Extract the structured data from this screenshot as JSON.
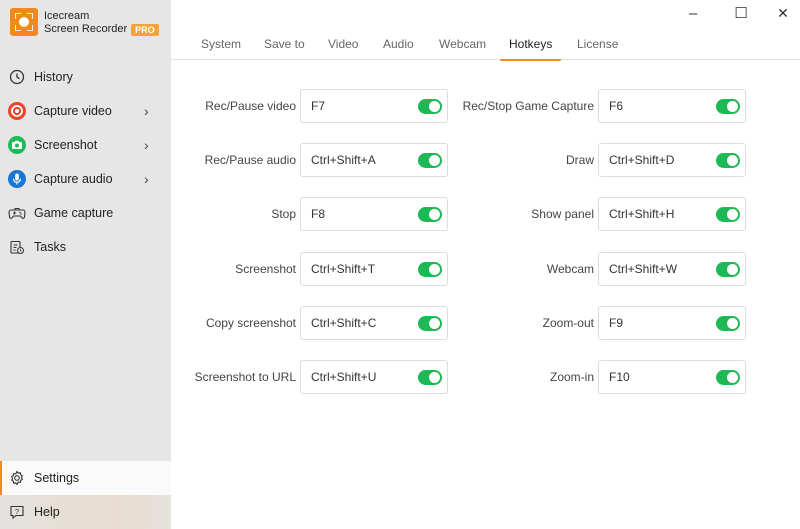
{
  "app": {
    "name_line1": "Icecream",
    "name_line2": "Screen Recorder",
    "badge": "PRO",
    "accent_color": "#f08a1c",
    "toggle_color": "#1db954"
  },
  "sidebar": {
    "items": [
      {
        "label": "History",
        "icon": "clock-icon",
        "has_submenu": false
      },
      {
        "label": "Capture video",
        "icon": "record-icon",
        "has_submenu": true,
        "color": "#e8452c"
      },
      {
        "label": "Screenshot",
        "icon": "camera-icon",
        "has_submenu": true,
        "color": "#1fba5a"
      },
      {
        "label": "Capture audio",
        "icon": "microphone-icon",
        "has_submenu": true,
        "color": "#1976d2"
      },
      {
        "label": "Game capture",
        "icon": "gamepad-icon",
        "has_submenu": false
      },
      {
        "label": "Tasks",
        "icon": "tasks-icon",
        "has_submenu": false
      }
    ],
    "bottom": [
      {
        "label": "Settings",
        "icon": "gear-icon",
        "active": true
      },
      {
        "label": "Help",
        "icon": "help-icon",
        "active": false
      }
    ],
    "chevron": "›"
  },
  "window": {
    "minimize": "–",
    "maximize": "☐",
    "close": "✕"
  },
  "tabs": [
    {
      "label": "System",
      "active": false
    },
    {
      "label": "Save to",
      "active": false
    },
    {
      "label": "Video",
      "active": false
    },
    {
      "label": "Audio",
      "active": false
    },
    {
      "label": "Webcam",
      "active": false
    },
    {
      "label": "Hotkeys",
      "active": true
    },
    {
      "label": "License",
      "active": false
    }
  ],
  "hotkeys": {
    "left": [
      {
        "label": "Rec/Pause video",
        "value": "F7",
        "enabled": true
      },
      {
        "label": "Rec/Pause audio",
        "value": "Ctrl+Shift+A",
        "enabled": true
      },
      {
        "label": "Stop",
        "value": "F8",
        "enabled": true
      },
      {
        "label": "Screenshot",
        "value": "Ctrl+Shift+T",
        "enabled": true
      },
      {
        "label": "Copy screenshot",
        "value": "Ctrl+Shift+C",
        "enabled": true
      },
      {
        "label": "Screenshot to URL",
        "value": "Ctrl+Shift+U",
        "enabled": true
      }
    ],
    "right": [
      {
        "label": "Rec/Stop Game Capture",
        "value": "F6",
        "enabled": true
      },
      {
        "label": "Draw",
        "value": "Ctrl+Shift+D",
        "enabled": true
      },
      {
        "label": "Show panel",
        "value": "Ctrl+Shift+H",
        "enabled": true
      },
      {
        "label": "Webcam",
        "value": "Ctrl+Shift+W",
        "enabled": true
      },
      {
        "label": "Zoom-out",
        "value": "F9",
        "enabled": true
      },
      {
        "label": "Zoom-in",
        "value": "F10",
        "enabled": true
      }
    ]
  }
}
